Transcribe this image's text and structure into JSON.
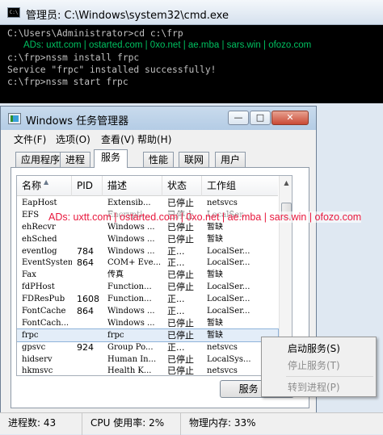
{
  "cmd": {
    "title": "管理员: C:\\Windows\\system32\\cmd.exe",
    "icon_text": "C:\\",
    "lines": [
      "C:\\Users\\Administrator>cd c:\\frp",
      "ADs: uxtt.com | ostarted.com | 0xo.net | ae.mba | sars.win | ofozo.com",
      "c:\\frp>nssm install frpc",
      "Service \"frpc\" installed successfully!",
      "",
      "c:\\frp>nssm start frpc"
    ]
  },
  "task_manager": {
    "title": "Windows 任务管理器",
    "controls": {
      "minimize": "—",
      "maximize": "□",
      "close": "✕"
    },
    "menu": [
      "文件(F)",
      "选项(O)",
      "查看(V)",
      "帮助(H)"
    ],
    "tabs": [
      "应用程序",
      "进程",
      "服务",
      "性能",
      "联网",
      "用户"
    ],
    "active_tab": "服务",
    "columns": [
      "名称",
      "PID",
      "描述",
      "状态",
      "工作组"
    ],
    "rows": [
      {
        "name": "EapHost",
        "pid": "",
        "desc": "Extensib...",
        "status": "已停止",
        "group": "netsvcs"
      },
      {
        "name": "EFS",
        "pid": "",
        "desc": "Encrypti...",
        "status": "已停止",
        "group": "LocalSer..."
      },
      {
        "name": "ehRecvr",
        "pid": "",
        "desc": "Windows ...",
        "status": "已停止",
        "group": "暂缺"
      },
      {
        "name": "ehSched",
        "pid": "",
        "desc": "Windows ...",
        "status": "已停止",
        "group": "暂缺"
      },
      {
        "name": "eventlog",
        "pid": "784",
        "desc": "Windows ...",
        "status": "正...",
        "group": "LocalSer..."
      },
      {
        "name": "EventSystem",
        "pid": "864",
        "desc": "COM+ Eve...",
        "status": "正...",
        "group": "LocalSer..."
      },
      {
        "name": "Fax",
        "pid": "",
        "desc": "传真",
        "status": "已停止",
        "group": "暂缺"
      },
      {
        "name": "fdPHost",
        "pid": "",
        "desc": "Function...",
        "status": "已停止",
        "group": "LocalSer..."
      },
      {
        "name": "FDResPub",
        "pid": "1608",
        "desc": "Function...",
        "status": "正...",
        "group": "LocalSer..."
      },
      {
        "name": "FontCache",
        "pid": "864",
        "desc": "Windows ...",
        "status": "正...",
        "group": "LocalSer..."
      },
      {
        "name": "FontCach...",
        "pid": "",
        "desc": "Windows ...",
        "status": "已停止",
        "group": "暂缺"
      },
      {
        "name": "frpc",
        "pid": "",
        "desc": "frpc",
        "status": "已停止",
        "group": "暂缺"
      },
      {
        "name": "gpsvc",
        "pid": "924",
        "desc": "Group Po...",
        "status": "正...",
        "group": "netsvcs"
      },
      {
        "name": "hidserv",
        "pid": "",
        "desc": "Human In...",
        "status": "已停止",
        "group": "LocalSys..."
      },
      {
        "name": "hkmsvc",
        "pid": "",
        "desc": "Health K...",
        "status": "已停止",
        "group": "netsvcs"
      }
    ],
    "selected_row": "frpc",
    "services_button": "服务 (S)",
    "ads_overlay": "ADs: uxtt.com | ostarted.com | 0xo.net | ae.mba | sars.win | ofozo.com"
  },
  "context_menu": {
    "items": [
      "启动服务(S)",
      "停止服务(T)",
      "转到进程(P)"
    ],
    "disabled": [
      "停止服务(T)",
      "转到进程(P)"
    ]
  },
  "statusbar": {
    "processes": "进程数: 43",
    "cpu": "CPU 使用率: 2%",
    "memory": "物理内存: 33%"
  },
  "colors": {
    "console_bg": "#000000",
    "console_text": "#c0c0c0",
    "console_ads": "#00c060",
    "ads_red": "#e8173c",
    "selection": "#e3edf8"
  }
}
